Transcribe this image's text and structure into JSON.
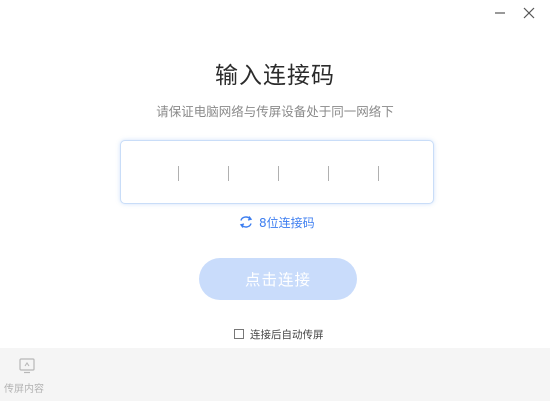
{
  "window_controls": {
    "minimize_icon": "minimize-icon",
    "close_icon": "close-icon"
  },
  "main": {
    "title": "输入连接码",
    "subtitle": "请保证电脑网络与传屏设备处于同一网络下",
    "code_input": {
      "slots": 6,
      "value": ""
    },
    "switch_mode": {
      "icon": "refresh-icon",
      "label": "8位连接码"
    },
    "connect_button": {
      "label": "点击连接",
      "state": "disabled"
    },
    "auto_share": {
      "checked": false,
      "label": "连接后自动传屏"
    }
  },
  "bottom_bar": {
    "share_content": {
      "icon": "screen-share-icon",
      "label": "传屏内容"
    }
  },
  "colors": {
    "accent": "#3d7ef0",
    "button_disabled": "#c9dcfb",
    "input_border": "#c9ddf8",
    "bottom_bar": "#f5f5f5"
  }
}
